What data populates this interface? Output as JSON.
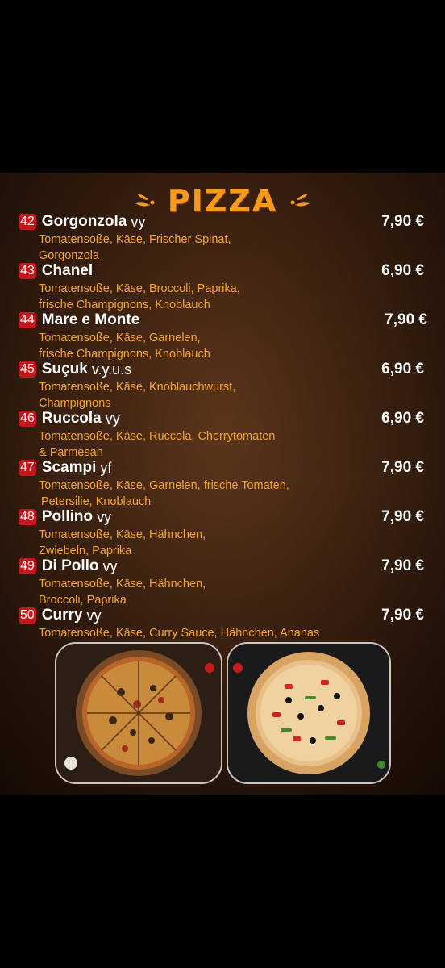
{
  "menu": {
    "title": "PIZZA",
    "accent_color": "#f59a1c",
    "items": [
      {
        "number": "42",
        "name": "Gorgonzola",
        "tag": "vy",
        "price": "7,90 €",
        "desc": [
          "Tomatensoße, Käse, Frischer Spinat,",
          "Gorgonzola"
        ]
      },
      {
        "number": "43",
        "name": "Chanel",
        "tag": "",
        "price": "6,90 €",
        "desc": [
          "Tomatensoße, Käse, Broccoli, Paprika,",
          "frische Champignons, Knoblauch"
        ]
      },
      {
        "number": "44",
        "name": "Mare e Monte",
        "tag": "",
        "price": "7,90 €",
        "desc": [
          "Tomatensoße, Käse, Garnelen,",
          "frische Champignons, Knoblauch"
        ]
      },
      {
        "number": "45",
        "name": "Suçuk",
        "tag": "v.y.u.s",
        "price": "6,90 €",
        "desc": [
          "Tomatensoße, Käse, Knoblauchwurst,",
          "Champignons"
        ]
      },
      {
        "number": "46",
        "name": "Ruccola",
        "tag": "vy",
        "price": "6,90 €",
        "desc": [
          "Tomatensoße, Käse, Ruccola, Cherrytomaten",
          "& Parmesan"
        ]
      },
      {
        "number": "47",
        "name": "Scampi",
        "tag": "yf",
        "price": "7,90 €",
        "desc": [
          "Tomatensoße, Käse, Garnelen, frische Tomaten,",
          " Petersilie, Knoblauch"
        ]
      },
      {
        "number": "48",
        "name": "Pollino",
        "tag": "vy",
        "price": "7,90 €",
        "desc": [
          "Tomatensoße, Käse, Hähnchen,",
          "Zwiebeln, Paprika"
        ]
      },
      {
        "number": "49",
        "name": "Di Pollo",
        "tag": "vy",
        "price": "7,90 €",
        "desc": [
          "Tomatensoße, Käse, Hähnchen,",
          "Broccoli, Paprika"
        ]
      },
      {
        "number": "50",
        "name": "Curry",
        "tag": "vy",
        "price": "7,90 €",
        "desc": [
          "Tomatensoße, Käse, Curry Sauce, Hähnchen, Ananas"
        ]
      }
    ]
  }
}
